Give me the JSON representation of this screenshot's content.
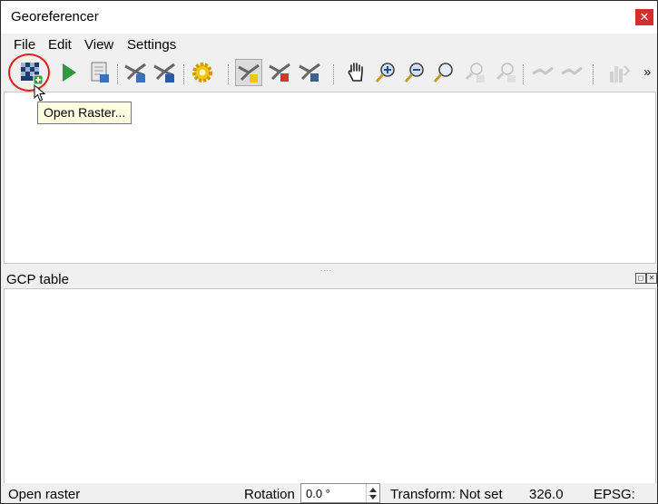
{
  "window": {
    "title": "Georeferencer",
    "close_label": "✕"
  },
  "menu": {
    "items": [
      "File",
      "Edit",
      "View",
      "Settings"
    ]
  },
  "toolbar": {
    "buttons": [
      {
        "name": "open-raster-button",
        "icon": "open-raster-icon",
        "enabled": true
      },
      {
        "name": "start-georeferencing-button",
        "icon": "play-icon",
        "enabled": true
      },
      {
        "name": "generate-gdal-script-button",
        "icon": "script-icon",
        "enabled": true
      },
      {
        "name": "load-gcp-points-button",
        "icon": "load-gcp-icon",
        "enabled": true
      },
      {
        "name": "save-gcp-points-button",
        "icon": "save-gcp-icon",
        "enabled": true
      },
      {
        "name": "transformation-settings-button",
        "icon": "gear-icon",
        "enabled": true
      },
      {
        "name": "add-point-button",
        "icon": "add-point-icon",
        "enabled": true,
        "pressed": true
      },
      {
        "name": "delete-point-button",
        "icon": "delete-point-icon",
        "enabled": true
      },
      {
        "name": "move-gcp-point-button",
        "icon": "move-point-icon",
        "enabled": true
      },
      {
        "name": "pan-button",
        "icon": "hand-icon",
        "enabled": true
      },
      {
        "name": "zoom-in-button",
        "icon": "zoom-in-icon",
        "enabled": true
      },
      {
        "name": "zoom-out-button",
        "icon": "zoom-out-icon",
        "enabled": true
      },
      {
        "name": "zoom-to-layer-button",
        "icon": "zoom-layer-icon",
        "enabled": true
      },
      {
        "name": "zoom-last-button",
        "icon": "zoom-last-icon",
        "enabled": false
      },
      {
        "name": "zoom-next-button",
        "icon": "zoom-next-icon",
        "enabled": false
      },
      {
        "name": "link-georeferencer-to-qgis-button",
        "icon": "link-geo-icon",
        "enabled": false
      },
      {
        "name": "link-qgis-to-georeferencer-button",
        "icon": "link-qgis-icon",
        "enabled": false
      },
      {
        "name": "full-histogram-stretch-button",
        "icon": "histogram-icon",
        "enabled": false
      }
    ],
    "more_label": "»"
  },
  "tooltip": {
    "text": "Open Raster..."
  },
  "gcp_dock": {
    "title": "GCP table",
    "float_label": "◻",
    "close_label": "✕"
  },
  "status": {
    "message": "Open raster",
    "rotation_label": "Rotation",
    "rotation_value": "0.0 °",
    "transform": "Transform: Not set",
    "coordinate": "326.0",
    "epsg_label": "EPSG:"
  },
  "colors": {
    "highlight": "#e0201d",
    "tooltip_bg": "#ffffe1",
    "play": "#2e9a3a",
    "gear": "#f2c30f"
  }
}
